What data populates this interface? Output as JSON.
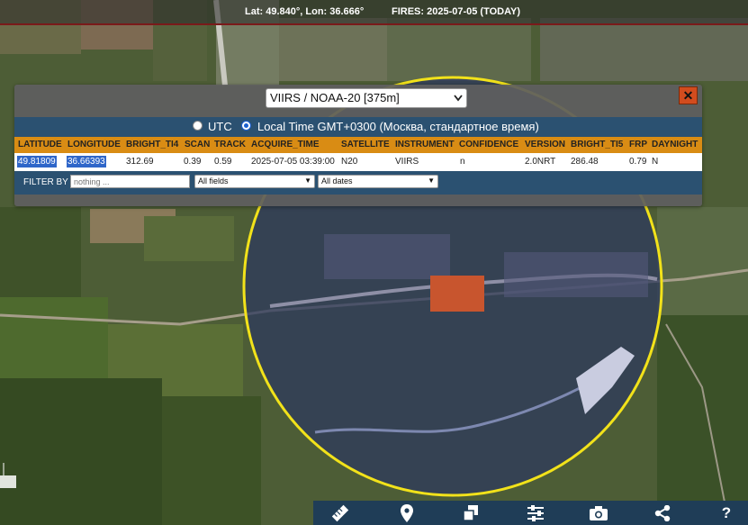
{
  "status": {
    "coords": "Lat: 49.840°, Lon: 36.666°",
    "fires": "FIRES: 2025-07-05 (TODAY)"
  },
  "panel": {
    "satellite_select": "VIIRS / NOAA-20 [375m]",
    "close_label": "✕",
    "timezone": {
      "utc_label": "UTC",
      "local_label": "Local Time GMT+0300 (Москва, стандартное время)",
      "selected": "local"
    },
    "columns": [
      "LATITUDE",
      "LONGITUDE",
      "BRIGHT_TI4",
      "SCAN",
      "TRACK",
      "ACQUIRE_TIME",
      "SATELLITE",
      "INSTRUMENT",
      "CONFIDENCE",
      "VERSION",
      "BRIGHT_TI5",
      "FRP",
      "DAYNIGHT"
    ],
    "rows": [
      [
        "49.81809",
        "36.66393",
        "312.69",
        "0.39",
        "0.59",
        "2025-07-05 03:39:00",
        "N20",
        "VIIRS",
        "n",
        "2.0NRT",
        "286.48",
        "0.79",
        "N"
      ]
    ],
    "filter": {
      "label": "FILTER BY",
      "placeholder": "nothing ...",
      "field_select": "All fields",
      "date_select": "All dates"
    }
  },
  "toolbar": {
    "icons": [
      "ruler-icon",
      "location-pin-icon",
      "copy-icon",
      "sliders-icon",
      "camera-icon",
      "share-icon"
    ],
    "help_label": "?"
  },
  "colors": {
    "header_orange": "#d98c14",
    "header_blue": "#2b5171",
    "fire_marker": "#c8552e",
    "radius_circle": "#f2e21a",
    "close_button": "#d24c1e",
    "toolbar": "#1f3d57"
  }
}
